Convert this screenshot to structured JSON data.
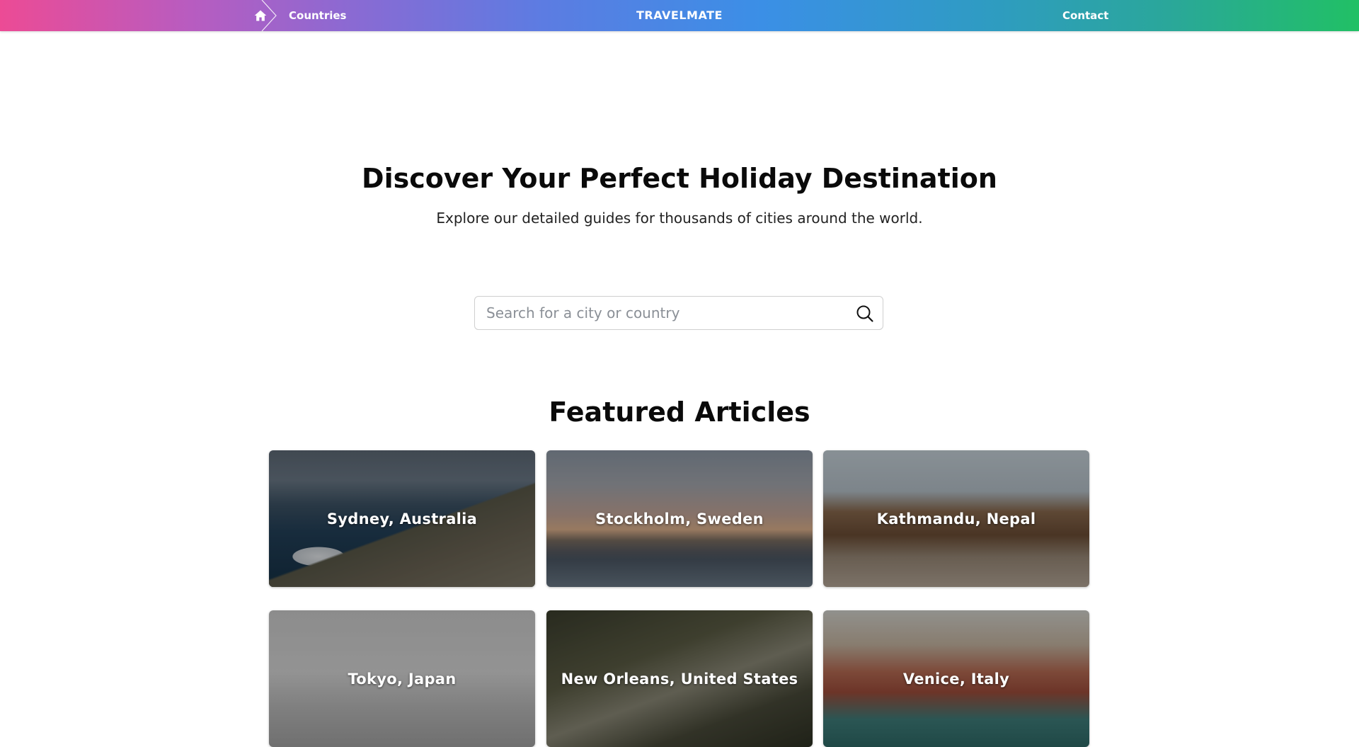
{
  "nav": {
    "home_icon": "home-icon",
    "countries_label": "Countries",
    "brand": "TRAVELMATE",
    "contact_label": "Contact"
  },
  "hero": {
    "title": "Discover Your Perfect Holiday Destination",
    "subtitle": "Explore our detailed guides for thousands of cities around the world."
  },
  "search": {
    "placeholder": "Search for a city or country",
    "value": "",
    "icon": "search-icon"
  },
  "featured": {
    "title": "Featured Articles",
    "articles": [
      {
        "label": "Sydney, Australia"
      },
      {
        "label": "Stockholm, Sweden"
      },
      {
        "label": "Kathmandu, Nepal"
      },
      {
        "label": "Tokyo, Japan"
      },
      {
        "label": "New Orleans, United States"
      },
      {
        "label": "Venice, Italy"
      }
    ]
  },
  "colors": {
    "header_gradient_start": "#ec4b95",
    "header_gradient_mid": "#3b8fe6",
    "header_gradient_end": "#21c065"
  }
}
